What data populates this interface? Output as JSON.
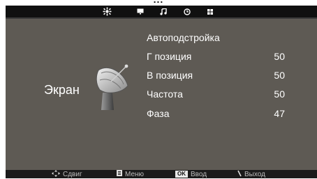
{
  "header": {
    "partial_text": "..."
  },
  "menu_tabs": [
    {
      "name": "settings-gear-icon",
      "glyph": "❄",
      "active": true
    },
    {
      "name": "tv-screen-icon",
      "glyph": "▣",
      "active": false
    },
    {
      "name": "music-note-icon",
      "glyph": "♫",
      "active": false
    },
    {
      "name": "clock-icon",
      "glyph": "◷",
      "active": false
    },
    {
      "name": "lock-icon",
      "glyph": "■",
      "active": false
    }
  ],
  "section": {
    "title": "Экран",
    "icon": "satellite-dish-icon"
  },
  "items": [
    {
      "label": "Автоподстройка",
      "value": ""
    },
    {
      "label": "Г позиция",
      "value": "50"
    },
    {
      "label": "В позиция",
      "value": "50"
    },
    {
      "label": "Частота",
      "value": "50"
    },
    {
      "label": "Фаза",
      "value": "47"
    }
  ],
  "footer": {
    "move_label": "Сдвиг",
    "menu_label": "Меню",
    "ok_key": "OK",
    "enter_label": "Ввод",
    "exit_label": "Выход"
  },
  "colors": {
    "panel_bg": "#5e5a54",
    "menu_bar_bg": "#101010",
    "footer_bg": "#1a1a1a",
    "text": "#ffffff"
  }
}
